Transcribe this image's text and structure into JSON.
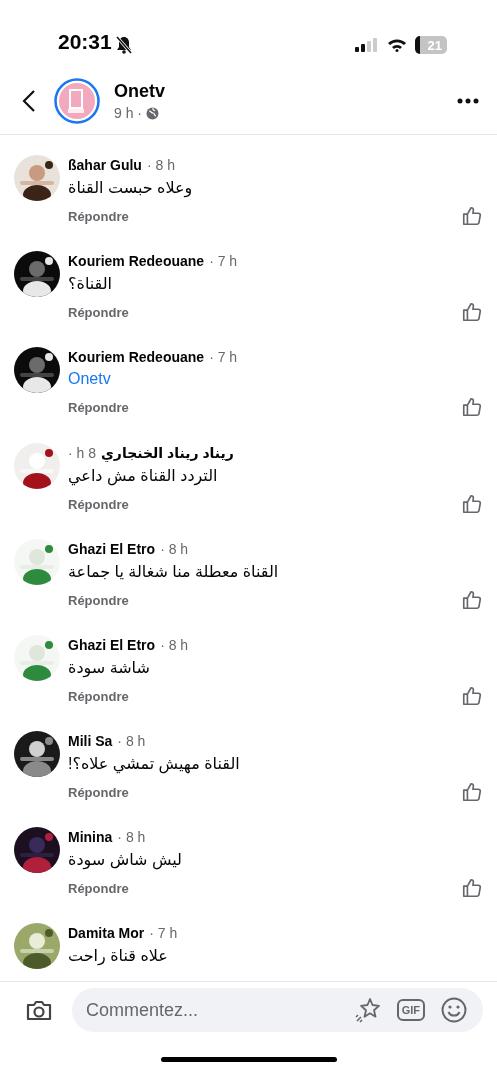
{
  "status_bar": {
    "time": "20:31",
    "battery": "21"
  },
  "header": {
    "title": "Onetv",
    "meta": "9 h ·"
  },
  "comments": [
    {
      "author": "ßahar Gulu",
      "time": "· 8 h",
      "text": "وعلاه حبست القناة",
      "reply": "Répondre"
    },
    {
      "author": "Kouriem Redeouane",
      "time": "· 7 h",
      "text": "القناة؟",
      "reply": "Répondre"
    },
    {
      "author": "Kouriem Redeouane",
      "time": "· 7 h",
      "text": "Onetv",
      "kind": "mention",
      "reply": "Répondre"
    },
    {
      "author": "ريناد ريناد الخنجاري",
      "time": "h 8 ·",
      "text": "التردد  القناة مش داعي",
      "rtl": true,
      "reply": "Répondre"
    },
    {
      "author": "Ghazi El Etro",
      "time": "· 8 h",
      "text": "القناة معطلة منا شغالة يا جماعة",
      "reply": "Répondre"
    },
    {
      "author": "Ghazi El Etro",
      "time": "· 8 h",
      "text": "شاشة سودة",
      "reply": "Répondre"
    },
    {
      "author": "Mili Sa",
      "time": "· 8 h",
      "text": "القناة مهيش تمشي علاه؟!",
      "reply": "Répondre"
    },
    {
      "author": "Minina",
      "time": "· 8 h",
      "text": "ليش شاش سودة",
      "reply": "Répondre"
    },
    {
      "author": "Damita Mor",
      "time": "· 7 h",
      "text": "علاه قناة راحت"
    }
  ],
  "composer": {
    "placeholder": "Commentez...",
    "gif": "GIF"
  }
}
